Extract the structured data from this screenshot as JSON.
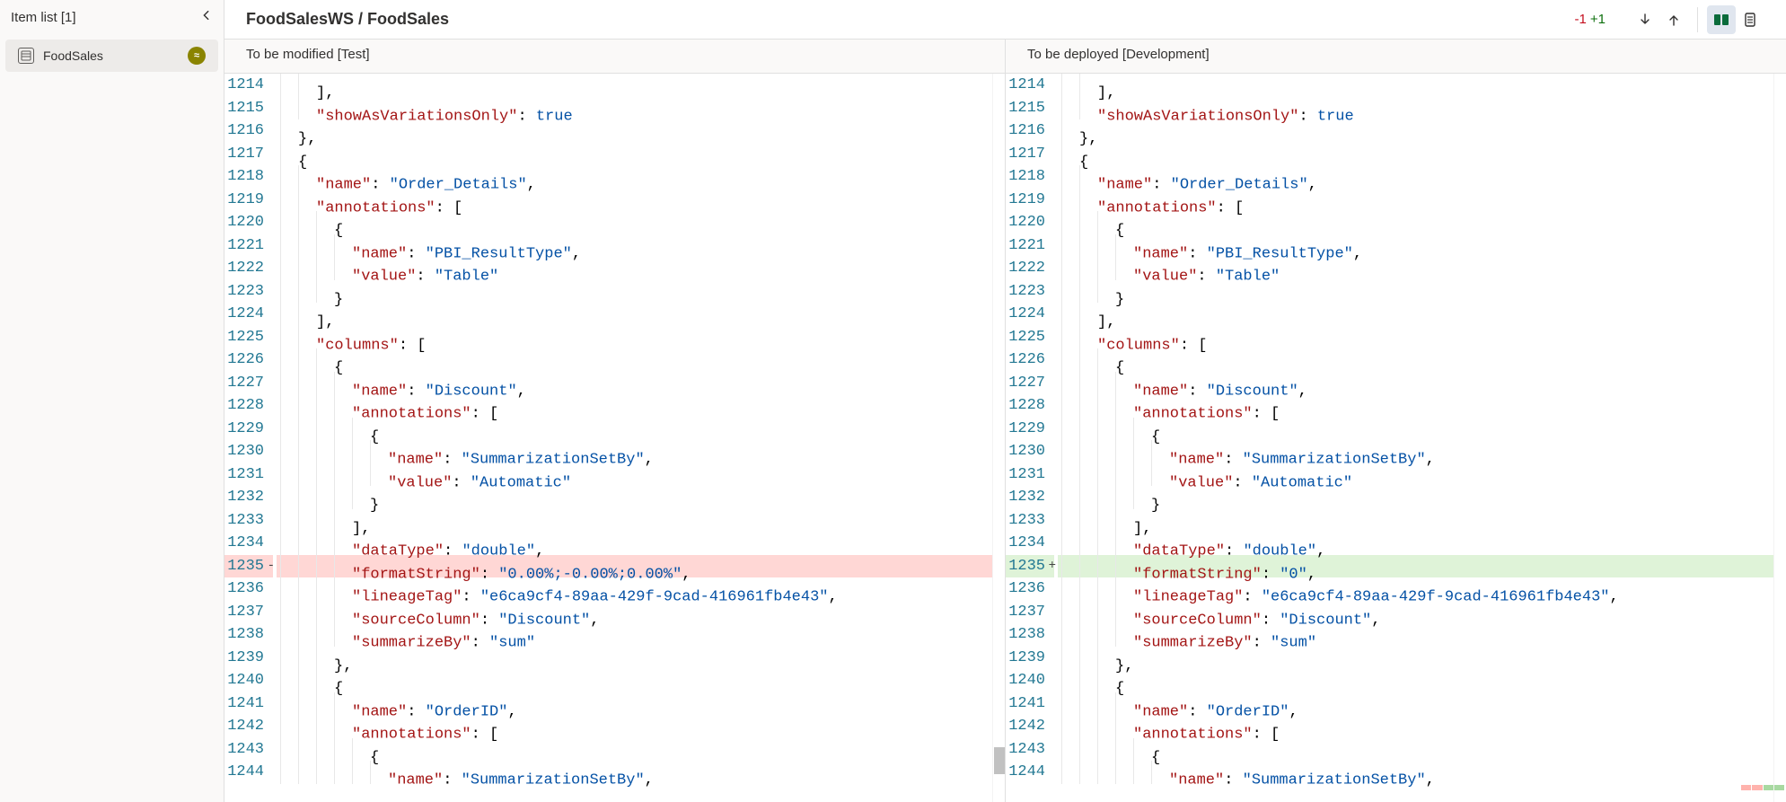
{
  "sidebar": {
    "title": "Item list [1]",
    "item_name": "FoodSales"
  },
  "header": {
    "breadcrumb": "FoodSalesWS / FoodSales",
    "removed_count": "-1",
    "added_count": "+1"
  },
  "panes": {
    "left_title": "To be modified [Test]",
    "right_title": "To be deployed [Development]"
  },
  "left_lines": [
    {
      "n": 1214,
      "indent": 2,
      "k": "",
      "pre_p": "],",
      "v": ""
    },
    {
      "n": 1215,
      "indent": 2,
      "k": "\"showAsVariationsOnly\"",
      "sep": ": ",
      "v": "true",
      "type": "bool"
    },
    {
      "n": 1216,
      "indent": 1,
      "k": "",
      "pre_p": "},",
      "v": ""
    },
    {
      "n": 1217,
      "indent": 1,
      "k": "",
      "pre_p": "{",
      "v": ""
    },
    {
      "n": 1218,
      "indent": 2,
      "k": "\"name\"",
      "sep": ": ",
      "v": "\"Order_Details\"",
      "tail": ",",
      "type": "str"
    },
    {
      "n": 1219,
      "indent": 2,
      "k": "\"annotations\"",
      "sep": ": ",
      "pre_p": "[",
      "v": ""
    },
    {
      "n": 1220,
      "indent": 3,
      "k": "",
      "pre_p": "{",
      "v": ""
    },
    {
      "n": 1221,
      "indent": 4,
      "k": "\"name\"",
      "sep": ": ",
      "v": "\"PBI_ResultType\"",
      "tail": ",",
      "type": "str"
    },
    {
      "n": 1222,
      "indent": 4,
      "k": "\"value\"",
      "sep": ": ",
      "v": "\"Table\"",
      "type": "str"
    },
    {
      "n": 1223,
      "indent": 3,
      "k": "",
      "pre_p": "}",
      "v": ""
    },
    {
      "n": 1224,
      "indent": 2,
      "k": "",
      "pre_p": "],",
      "v": ""
    },
    {
      "n": 1225,
      "indent": 2,
      "k": "\"columns\"",
      "sep": ": ",
      "pre_p": "[",
      "v": ""
    },
    {
      "n": 1226,
      "indent": 3,
      "k": "",
      "pre_p": "{",
      "v": ""
    },
    {
      "n": 1227,
      "indent": 4,
      "k": "\"name\"",
      "sep": ": ",
      "v": "\"Discount\"",
      "tail": ",",
      "type": "str"
    },
    {
      "n": 1228,
      "indent": 4,
      "k": "\"annotations\"",
      "sep": ": ",
      "pre_p": "[",
      "v": ""
    },
    {
      "n": 1229,
      "indent": 5,
      "k": "",
      "pre_p": "{",
      "v": ""
    },
    {
      "n": 1230,
      "indent": 6,
      "k": "\"name\"",
      "sep": ": ",
      "v": "\"SummarizationSetBy\"",
      "tail": ",",
      "type": "str"
    },
    {
      "n": 1231,
      "indent": 6,
      "k": "\"value\"",
      "sep": ": ",
      "v": "\"Automatic\"",
      "type": "str"
    },
    {
      "n": 1232,
      "indent": 5,
      "k": "",
      "pre_p": "}",
      "v": ""
    },
    {
      "n": 1233,
      "indent": 4,
      "k": "",
      "pre_p": "],",
      "v": ""
    },
    {
      "n": 1234,
      "indent": 4,
      "k": "\"dataType\"",
      "sep": ": ",
      "v": "\"double\"",
      "tail": ",",
      "type": "str"
    },
    {
      "n": 1235,
      "indent": 4,
      "k": "\"formatString\"",
      "sep": ": ",
      "v": "\"0.00%;-0.00%;0.00%\"",
      "tail": ",",
      "type": "str",
      "diff": "removed"
    },
    {
      "n": 1236,
      "indent": 4,
      "k": "\"lineageTag\"",
      "sep": ": ",
      "v": "\"e6ca9cf4-89aa-429f-9cad-416961fb4e43\"",
      "tail": ",",
      "type": "str"
    },
    {
      "n": 1237,
      "indent": 4,
      "k": "\"sourceColumn\"",
      "sep": ": ",
      "v": "\"Discount\"",
      "tail": ",",
      "type": "str"
    },
    {
      "n": 1238,
      "indent": 4,
      "k": "\"summarizeBy\"",
      "sep": ": ",
      "v": "\"sum\"",
      "type": "str"
    },
    {
      "n": 1239,
      "indent": 3,
      "k": "",
      "pre_p": "},",
      "v": ""
    },
    {
      "n": 1240,
      "indent": 3,
      "k": "",
      "pre_p": "{",
      "v": ""
    },
    {
      "n": 1241,
      "indent": 4,
      "k": "\"name\"",
      "sep": ": ",
      "v": "\"OrderID\"",
      "tail": ",",
      "type": "str"
    },
    {
      "n": 1242,
      "indent": 4,
      "k": "\"annotations\"",
      "sep": ": ",
      "pre_p": "[",
      "v": ""
    },
    {
      "n": 1243,
      "indent": 5,
      "k": "",
      "pre_p": "{",
      "v": ""
    },
    {
      "n": 1244,
      "indent": 6,
      "k": "\"name\"",
      "sep": ": ",
      "v": "\"SummarizationSetBy\"",
      "tail": ",",
      "type": "str"
    }
  ],
  "right_lines": [
    {
      "n": 1214,
      "indent": 2,
      "k": "",
      "pre_p": "],",
      "v": ""
    },
    {
      "n": 1215,
      "indent": 2,
      "k": "\"showAsVariationsOnly\"",
      "sep": ": ",
      "v": "true",
      "type": "bool"
    },
    {
      "n": 1216,
      "indent": 1,
      "k": "",
      "pre_p": "},",
      "v": ""
    },
    {
      "n": 1217,
      "indent": 1,
      "k": "",
      "pre_p": "{",
      "v": ""
    },
    {
      "n": 1218,
      "indent": 2,
      "k": "\"name\"",
      "sep": ": ",
      "v": "\"Order_Details\"",
      "tail": ",",
      "type": "str"
    },
    {
      "n": 1219,
      "indent": 2,
      "k": "\"annotations\"",
      "sep": ": ",
      "pre_p": "[",
      "v": ""
    },
    {
      "n": 1220,
      "indent": 3,
      "k": "",
      "pre_p": "{",
      "v": ""
    },
    {
      "n": 1221,
      "indent": 4,
      "k": "\"name\"",
      "sep": ": ",
      "v": "\"PBI_ResultType\"",
      "tail": ",",
      "type": "str"
    },
    {
      "n": 1222,
      "indent": 4,
      "k": "\"value\"",
      "sep": ": ",
      "v": "\"Table\"",
      "type": "str"
    },
    {
      "n": 1223,
      "indent": 3,
      "k": "",
      "pre_p": "}",
      "v": ""
    },
    {
      "n": 1224,
      "indent": 2,
      "k": "",
      "pre_p": "],",
      "v": ""
    },
    {
      "n": 1225,
      "indent": 2,
      "k": "\"columns\"",
      "sep": ": ",
      "pre_p": "[",
      "v": ""
    },
    {
      "n": 1226,
      "indent": 3,
      "k": "",
      "pre_p": "{",
      "v": ""
    },
    {
      "n": 1227,
      "indent": 4,
      "k": "\"name\"",
      "sep": ": ",
      "v": "\"Discount\"",
      "tail": ",",
      "type": "str"
    },
    {
      "n": 1228,
      "indent": 4,
      "k": "\"annotations\"",
      "sep": ": ",
      "pre_p": "[",
      "v": ""
    },
    {
      "n": 1229,
      "indent": 5,
      "k": "",
      "pre_p": "{",
      "v": ""
    },
    {
      "n": 1230,
      "indent": 6,
      "k": "\"name\"",
      "sep": ": ",
      "v": "\"SummarizationSetBy\"",
      "tail": ",",
      "type": "str"
    },
    {
      "n": 1231,
      "indent": 6,
      "k": "\"value\"",
      "sep": ": ",
      "v": "\"Automatic\"",
      "type": "str"
    },
    {
      "n": 1232,
      "indent": 5,
      "k": "",
      "pre_p": "}",
      "v": ""
    },
    {
      "n": 1233,
      "indent": 4,
      "k": "",
      "pre_p": "],",
      "v": ""
    },
    {
      "n": 1234,
      "indent": 4,
      "k": "\"dataType\"",
      "sep": ": ",
      "v": "\"double\"",
      "tail": ",",
      "type": "str"
    },
    {
      "n": 1235,
      "indent": 4,
      "k": "\"formatString\"",
      "sep": ": ",
      "v": "\"0\"",
      "tail": ",",
      "type": "str",
      "diff": "added"
    },
    {
      "n": 1236,
      "indent": 4,
      "k": "\"lineageTag\"",
      "sep": ": ",
      "v": "\"e6ca9cf4-89aa-429f-9cad-416961fb4e43\"",
      "tail": ",",
      "type": "str"
    },
    {
      "n": 1237,
      "indent": 4,
      "k": "\"sourceColumn\"",
      "sep": ": ",
      "v": "\"Discount\"",
      "tail": ",",
      "type": "str"
    },
    {
      "n": 1238,
      "indent": 4,
      "k": "\"summarizeBy\"",
      "sep": ": ",
      "v": "\"sum\"",
      "type": "str"
    },
    {
      "n": 1239,
      "indent": 3,
      "k": "",
      "pre_p": "},",
      "v": ""
    },
    {
      "n": 1240,
      "indent": 3,
      "k": "",
      "pre_p": "{",
      "v": ""
    },
    {
      "n": 1241,
      "indent": 4,
      "k": "\"name\"",
      "sep": ": ",
      "v": "\"OrderID\"",
      "tail": ",",
      "type": "str"
    },
    {
      "n": 1242,
      "indent": 4,
      "k": "\"annotations\"",
      "sep": ": ",
      "pre_p": "[",
      "v": ""
    },
    {
      "n": 1243,
      "indent": 5,
      "k": "",
      "pre_p": "{",
      "v": ""
    },
    {
      "n": 1244,
      "indent": 6,
      "k": "\"name\"",
      "sep": ": ",
      "v": "\"SummarizationSetBy\"",
      "tail": ",",
      "type": "str"
    }
  ]
}
